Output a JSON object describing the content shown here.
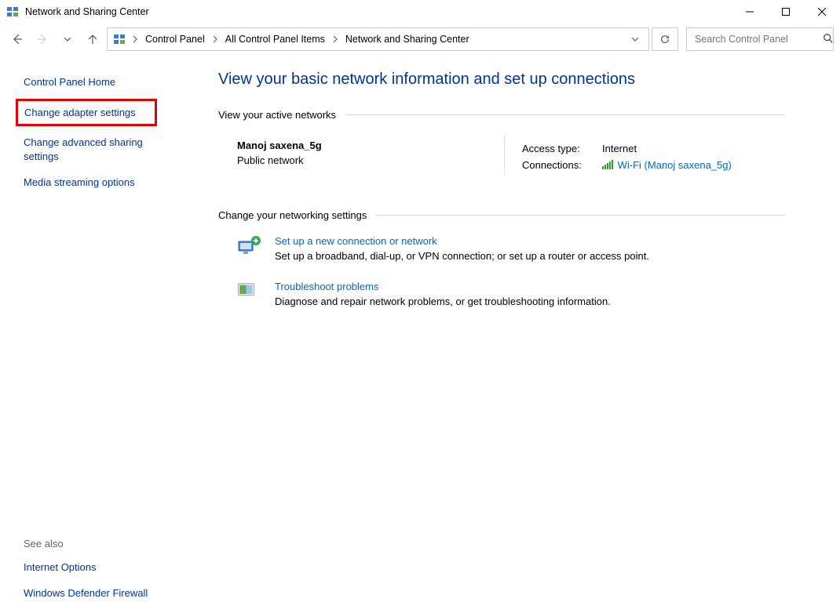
{
  "window": {
    "title": "Network and Sharing Center"
  },
  "breadcrumbs": {
    "item0": "Control Panel",
    "item1": "All Control Panel Items",
    "item2": "Network and Sharing Center"
  },
  "search": {
    "placeholder": "Search Control Panel"
  },
  "sidebar": {
    "home": "Control Panel Home",
    "adapter": "Change adapter settings",
    "advanced": "Change advanced sharing settings",
    "media": "Media streaming options",
    "seealso_label": "See also",
    "internet_options": "Internet Options",
    "firewall": "Windows Defender Firewall"
  },
  "main": {
    "title": "View your basic network information and set up connections",
    "section_active": "View your active networks",
    "network": {
      "name": "Manoj saxena_5g",
      "type": "Public network",
      "access_label": "Access type:",
      "access_value": "Internet",
      "conn_label": "Connections:",
      "conn_value": "Wi-Fi (Manoj saxena_5g)"
    },
    "section_change": "Change your networking settings",
    "task1": {
      "title": "Set up a new connection or network",
      "desc": "Set up a broadband, dial-up, or VPN connection; or set up a router or access point."
    },
    "task2": {
      "title": "Troubleshoot problems",
      "desc": "Diagnose and repair network problems, or get troubleshooting information."
    }
  }
}
